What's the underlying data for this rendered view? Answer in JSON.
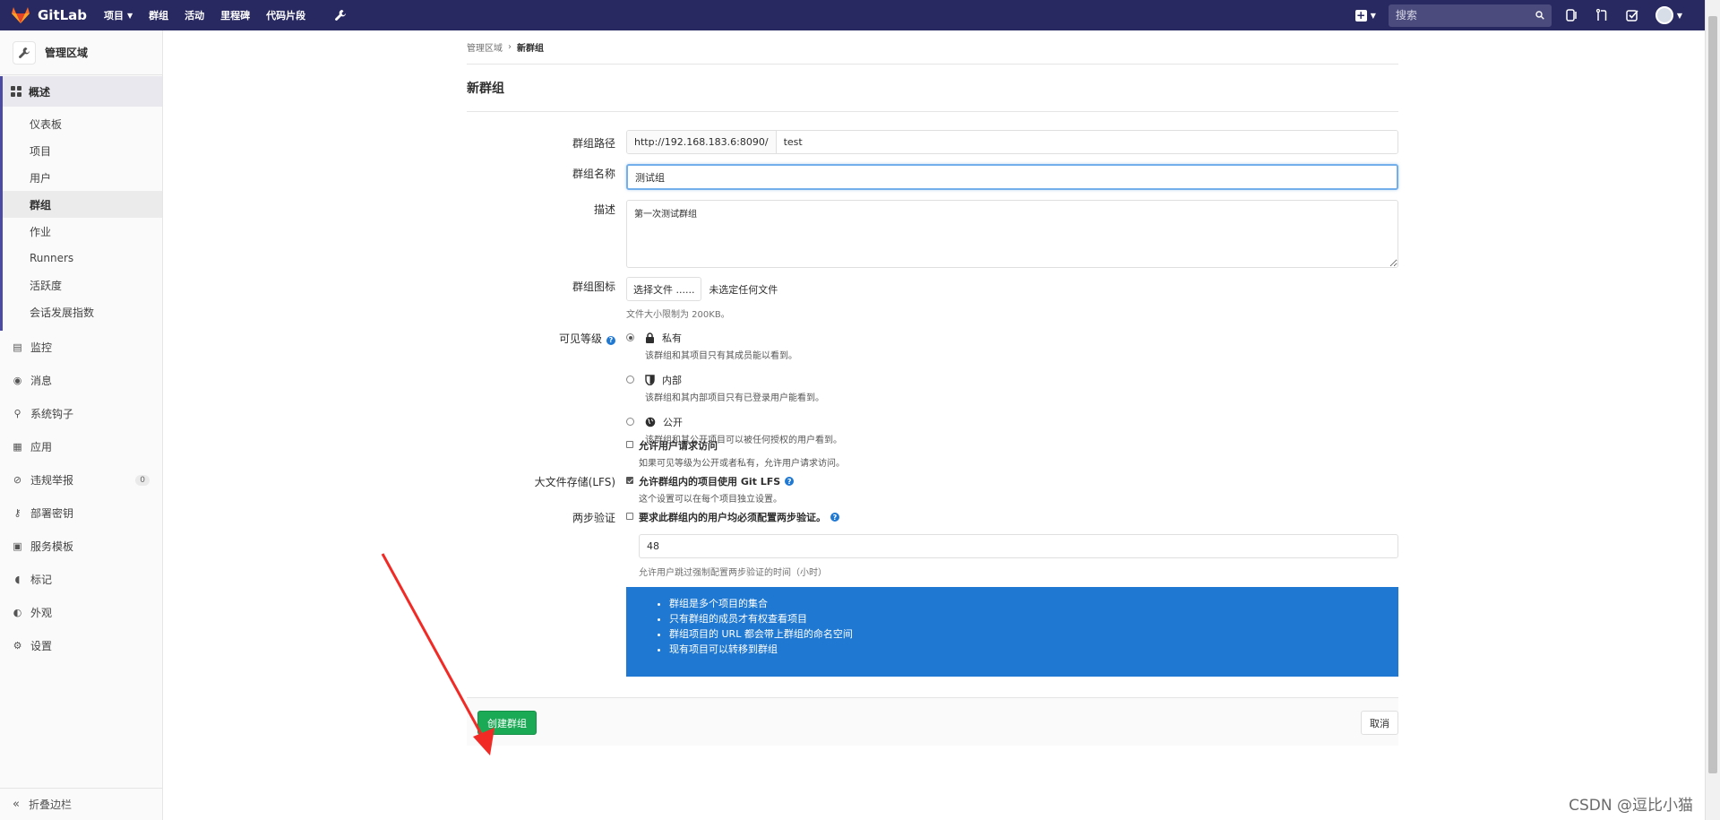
{
  "topbar": {
    "logo_text": "GitLab",
    "nav": [
      {
        "label": "项目",
        "has_caret": true
      },
      {
        "label": "群组",
        "has_caret": false
      },
      {
        "label": "活动",
        "has_caret": false
      },
      {
        "label": "里程碑",
        "has_caret": false
      },
      {
        "label": "代码片段",
        "has_caret": false
      }
    ],
    "search_placeholder": "搜索",
    "brand_color": "#292961"
  },
  "sidebar": {
    "header_title": "管理区域",
    "group_title": "概述",
    "subitems": [
      "仪表板",
      "项目",
      "用户",
      "群组",
      "作业",
      "Runners",
      "活跃度",
      "会话发展指数"
    ],
    "active_subitem": "群组",
    "items": [
      {
        "label": "监控",
        "icon": "monitor-icon"
      },
      {
        "label": "消息",
        "icon": "broadcast-icon"
      },
      {
        "label": "系统钩子",
        "icon": "hook-icon"
      },
      {
        "label": "应用",
        "icon": "apps-icon"
      },
      {
        "label": "违规举报",
        "icon": "abuse-report-icon",
        "badge": "0"
      },
      {
        "label": "部署密钥",
        "icon": "key-icon"
      },
      {
        "label": "服务模板",
        "icon": "template-icon"
      },
      {
        "label": "标记",
        "icon": "label-icon"
      },
      {
        "label": "外观",
        "icon": "appearance-icon"
      },
      {
        "label": "设置",
        "icon": "gear-icon"
      }
    ],
    "collapse_label": "折叠边栏"
  },
  "breadcrumb": {
    "parent": "管理区域",
    "separator": "›",
    "current": "新群组"
  },
  "page_title": "新群组",
  "form": {
    "path_label": "群组路径",
    "path_prefix": "http://192.168.183.6:8090/",
    "path_value": "test",
    "name_label": "群组名称",
    "name_value": "测试组",
    "desc_label": "描述",
    "desc_value": "第一次测试群组",
    "avatar_label": "群组图标",
    "file_button": "选择文件 ......",
    "file_status": "未选定任何文件",
    "file_help": "文件大小限制为 200KB。",
    "visibility_label": "可见等级",
    "visibility_options": [
      {
        "title": "私有",
        "desc": "该群组和其项目只有其成员能以看到。",
        "checked": true,
        "icon": "lock-icon"
      },
      {
        "title": "内部",
        "desc": "该群组和其内部项目只有已登录用户能看到。",
        "checked": false,
        "icon": "shield-icon"
      },
      {
        "title": "公开",
        "desc": "该群组和其公开项目可以被任何授权的用户看到。",
        "checked": false,
        "icon": "globe-icon"
      }
    ],
    "request_access_title": "允许用户请求访问",
    "request_access_desc": "如果可见等级为公开或者私有，允许用户请求访问。",
    "lfs_label": "大文件存储(LFS)",
    "lfs_title": "允许群组内的项目使用 Git LFS",
    "lfs_desc": "这个设置可以在每个项目独立设置。",
    "tfa_label": "两步验证",
    "tfa_title": "要求此群组内的用户均必须配置两步验证。",
    "grace_value": "48",
    "grace_help": "允许用户跳过强制配置两步验证的时间（小时）",
    "info_items": [
      "群组是多个项目的集合",
      "只有群组的成员才有权查看项目",
      "群组项目的 URL 都会带上群组的命名空间",
      "现有项目可以转移到群组"
    ],
    "info_color": "#1f78d1"
  },
  "actions": {
    "create": "创建群组",
    "cancel": "取消",
    "create_color": "#1aaa55"
  },
  "watermark": "CSDN @逗比小猫"
}
